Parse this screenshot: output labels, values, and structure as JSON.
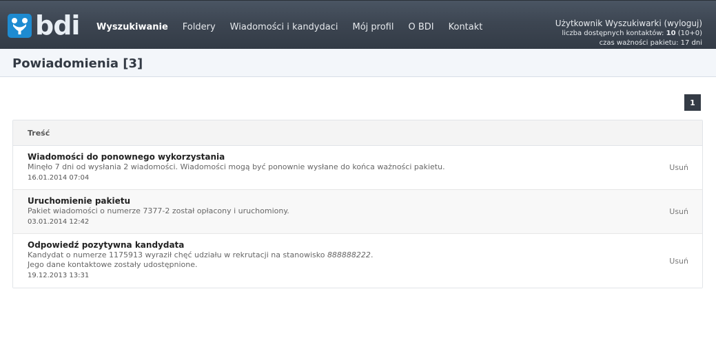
{
  "header": {
    "logo_text": "bdi",
    "nav": [
      {
        "label": "Wyszukiwanie",
        "active": true
      },
      {
        "label": "Foldery",
        "active": false
      },
      {
        "label": "Wiadomości i kandydaci",
        "active": false
      },
      {
        "label": "Mój profil",
        "active": false
      },
      {
        "label": "O BDI",
        "active": false
      },
      {
        "label": "Kontakt",
        "active": false
      }
    ],
    "user": {
      "name": "Użytkownik Wyszukiwarki",
      "logout": "(wyloguj)",
      "contacts_label": "liczba dostępnych kontaktów:",
      "contacts_value": "10",
      "contacts_extra": "(10+0)",
      "validity_label": "czas ważności pakietu:",
      "validity_value": "17 dni"
    }
  },
  "page": {
    "title": "Powiadomienia [3]",
    "pager_current": "1"
  },
  "table": {
    "header": "Treść",
    "delete_label": "Usuń",
    "rows": [
      {
        "title": "Wiadomości do ponownego wykorzystania",
        "text": "Minęło 7 dni od wysłania 2 wiadomości. Wiadomości mogą być ponownie wysłane do końca ważności pakietu.",
        "date": "16.01.2014 07:04"
      },
      {
        "title": "Uruchomienie pakietu",
        "text": "Pakiet wiadomości o numerze 7377-2 został opłacony i uruchomiony.",
        "date": "03.01.2014 12:42"
      },
      {
        "title": "Odpowiedź pozytywna kandydata",
        "text_prefix": "Kandydat o numerze 1175913 wyraził chęć udziału w rekrutacji na stanowisko",
        "text_position": "888888222",
        "text_suffix": ".",
        "text_line2": "Jego dane kontaktowe zostały udostępnione.",
        "date": "19.12.2013 13:31"
      }
    ]
  }
}
